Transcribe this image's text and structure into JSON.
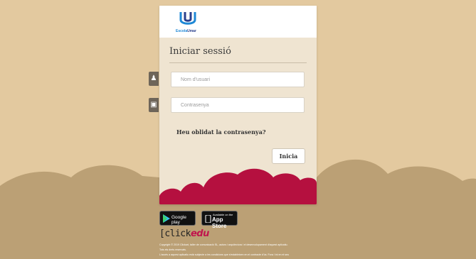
{
  "login": {
    "title": "Iniciar sessió",
    "username_placeholder": "Nom d'usuari",
    "password_placeholder": "Contrasenya",
    "forgot_link": "Heu oblidat la contrasenya?",
    "submit_label": "Inicia"
  },
  "logo": {
    "text_part1": "Escola",
    "text_part2": "Umar"
  },
  "stores": {
    "google_play": "Google play",
    "app_store_small": "Available on the",
    "app_store_big": "App Store"
  },
  "footer": {
    "brand_part1": "[click",
    "brand_part2": "edu",
    "copyright_line1": "Copyright © 2019 Clickart, taller de comunicació SL, autors i arquitectura i el desenvolupament d'aquest aplicatiu.",
    "copyright_line2": "Tots els drets reservats.",
    "copyright_line3": "L'accés a aquest aplicatiu està subjecte a les condicions que s'estableixen en el contracte d'ús. Fora / ini en el seu"
  },
  "colors": {
    "background": "#e3c99f",
    "hills": "#bba075",
    "card": "#efe4d1",
    "accent": "#b5103f",
    "logo_blue": "#1e88d6"
  }
}
